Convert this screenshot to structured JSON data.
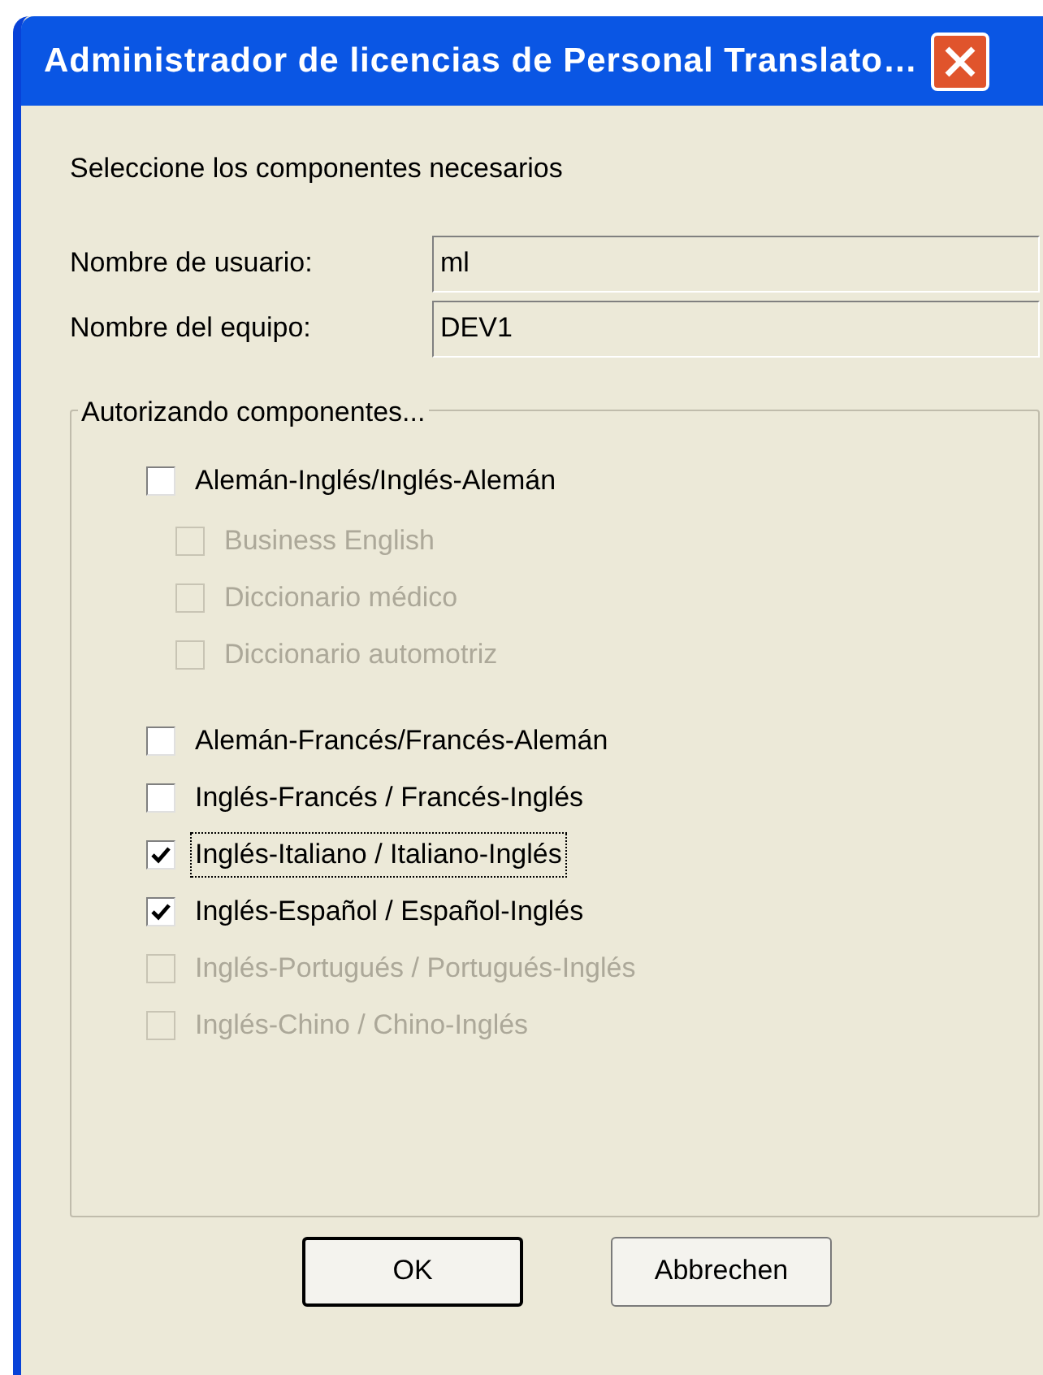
{
  "window": {
    "title": "Administrador de licencias de Personal Translato…"
  },
  "intro": "Seleccione los componentes necesarios",
  "fields": [
    {
      "label": "Nombre de usuario:",
      "value": "ml"
    },
    {
      "label": "Nombre del equipo:",
      "value": "DEV1"
    }
  ],
  "group": {
    "title": "Autorizando componentes...",
    "items": [
      {
        "label": "Alemán-Inglés/Inglés-Alemán",
        "checked": false,
        "disabled": false,
        "focused": false,
        "children": [
          {
            "label": "Business English",
            "checked": false,
            "disabled": true,
            "focused": false
          },
          {
            "label": "Diccionario médico",
            "checked": false,
            "disabled": true,
            "focused": false
          },
          {
            "label": "Diccionario automotriz",
            "checked": false,
            "disabled": true,
            "focused": false
          }
        ]
      },
      {
        "label": "Alemán-Francés/Francés-Alemán",
        "checked": false,
        "disabled": false,
        "focused": false
      },
      {
        "label": "Inglés-Francés / Francés-Inglés",
        "checked": false,
        "disabled": false,
        "focused": false
      },
      {
        "label": "Inglés-Italiano / Italiano-Inglés",
        "checked": true,
        "disabled": false,
        "focused": true
      },
      {
        "label": "Inglés-Español / Español-Inglés",
        "checked": true,
        "disabled": false,
        "focused": false
      },
      {
        "label": "Inglés-Portugués / Portugués-Inglés",
        "checked": false,
        "disabled": true,
        "focused": false
      },
      {
        "label": "Inglés-Chino / Chino-Inglés",
        "checked": false,
        "disabled": true,
        "focused": false
      }
    ]
  },
  "buttons": [
    {
      "label": "OK",
      "default": true
    },
    {
      "label": "Abbrechen",
      "default": false
    }
  ]
}
